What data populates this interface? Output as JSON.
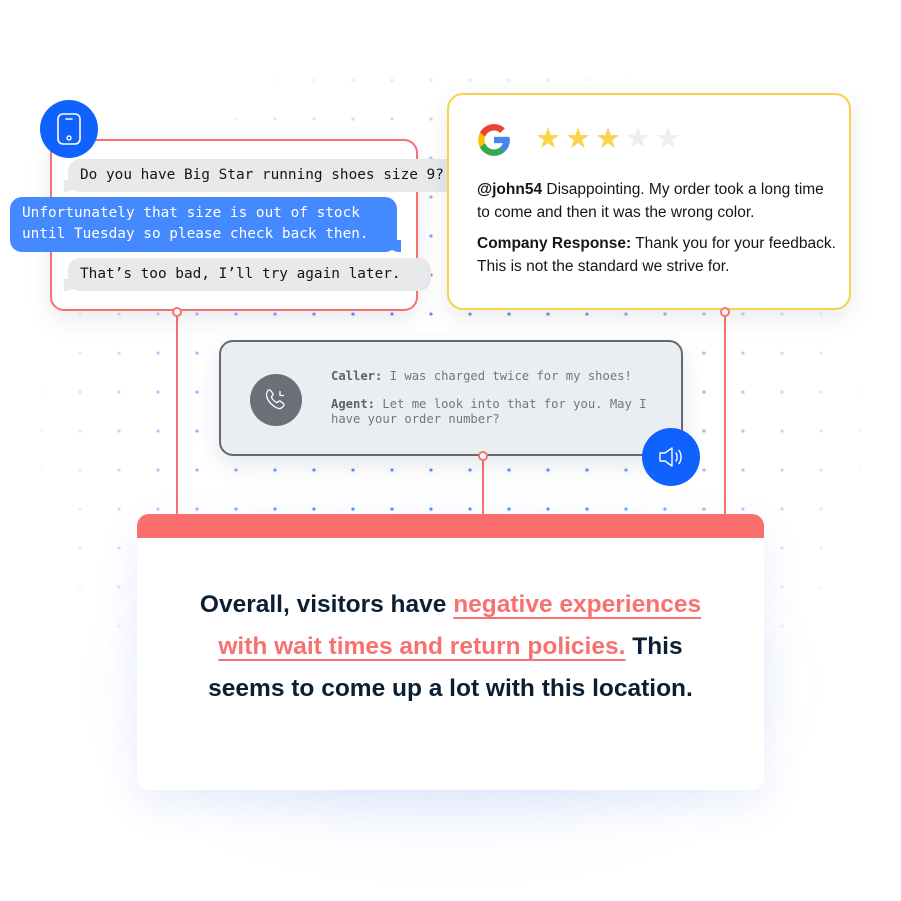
{
  "colors": {
    "brand_blue": "#0f62fe",
    "bubble_blue": "#4589ff",
    "connector_red": "#f87171",
    "summary_header": "#fa6e6e",
    "review_border": "#f8d34a",
    "call_border": "#5f6a74",
    "star_filled": "#fcd34d",
    "star_empty": "#eceef0",
    "text_dark": "#0b1f33"
  },
  "chat": {
    "channel_icon": "mobile-phone-icon",
    "messages": [
      {
        "from": "customer",
        "text": "Do you have Big Star running shoes size 9?"
      },
      {
        "from": "agent",
        "text": "Unfortunately that size is out of stock\nuntil Tuesday so please check back then."
      },
      {
        "from": "customer",
        "text": "That’s too bad, I’ll try again later."
      }
    ]
  },
  "review": {
    "source_icon": "google-logo-icon",
    "rating": 3,
    "rating_max": 5,
    "star_glyph": "★",
    "author": "@john54",
    "text": " Disappointing. My order took a long time to come and then it was the wrong color.",
    "response_label": "Company Response:",
    "response_text": " Thank you for your feedback. This is not the standard we strive for."
  },
  "call": {
    "channel_icon": "phone-call-icon",
    "audio_icon": "speaker-volume-icon",
    "lines": [
      {
        "speaker": "Caller:",
        "text": " I was charged twice for my shoes!"
      },
      {
        "speaker": "Agent:",
        "text": " Let me look into that for you. May I have your order number?"
      }
    ]
  },
  "summary": {
    "text_before": "Overall, visitors have ",
    "highlight": "negative experiences with wait times and return policies.",
    "text_after": " This seems to come up a lot with this location."
  }
}
